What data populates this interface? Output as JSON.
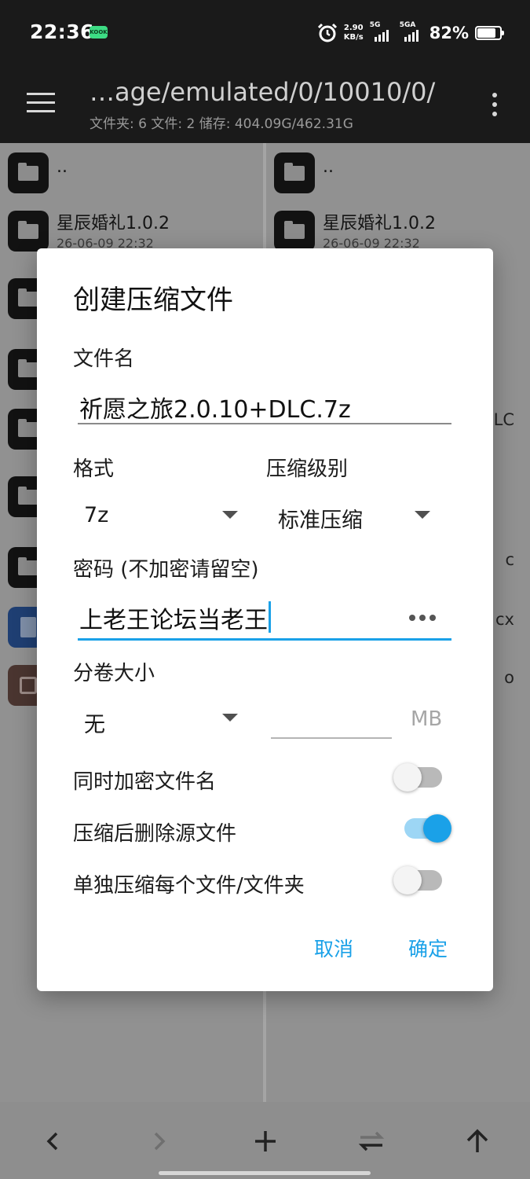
{
  "status_bar": {
    "time": "22:36",
    "app_badge": "KOOK",
    "speed_value": "2.90",
    "speed_unit": "KB/s",
    "net1": "5G",
    "net2": "5GA",
    "battery": "82%",
    "battery_level": 0.82,
    "icons": [
      "alarm-icon",
      "signal-icon",
      "battery-icon"
    ]
  },
  "toolbar": {
    "path": "…age/emulated/0/10010/0/",
    "info": "文件夹: 6  文件: 2  储存: 404.09G/462.31G"
  },
  "left_pane": {
    "parent": "..",
    "item1_name": "星辰婚礼1.0.2",
    "item1_date": "26-06-09 22:32"
  },
  "right_pane": {
    "parent": "..",
    "item1_name": "星辰婚礼1.0.2",
    "item1_date": "26-06-09 22:32",
    "frag_lc": "LC",
    "frag_c": "c",
    "frag_cx": "cx",
    "frag_o": "o"
  },
  "dialog": {
    "title": "创建压缩文件",
    "filename_label": "文件名",
    "filename_value": "祈愿之旅2.0.10+DLC.7z",
    "format_label": "格式",
    "format_value": "7z",
    "level_label": "压缩级别",
    "level_value": "标准压缩",
    "password_label": "密码 (不加密请留空)",
    "password_value": "上老王论坛当老王",
    "volume_label": "分卷大小",
    "volume_value": "无",
    "volume_size_value": "",
    "volume_unit": "MB",
    "toggles": [
      {
        "label": "同时加密文件名",
        "on": false
      },
      {
        "label": "压缩后删除源文件",
        "on": true
      },
      {
        "label": "单独压缩每个文件/文件夹",
        "on": false
      }
    ],
    "cancel": "取消",
    "confirm": "确定"
  },
  "bottom_bar": {
    "icons": [
      "back-arrow-icon",
      "forward-arrow-icon",
      "add-icon",
      "swap-icon",
      "up-arrow-icon"
    ]
  },
  "colors": {
    "accent": "#1aa1e8",
    "toolbar_bg": "#1a1a1a",
    "dialog_bg": "#ffffff"
  }
}
